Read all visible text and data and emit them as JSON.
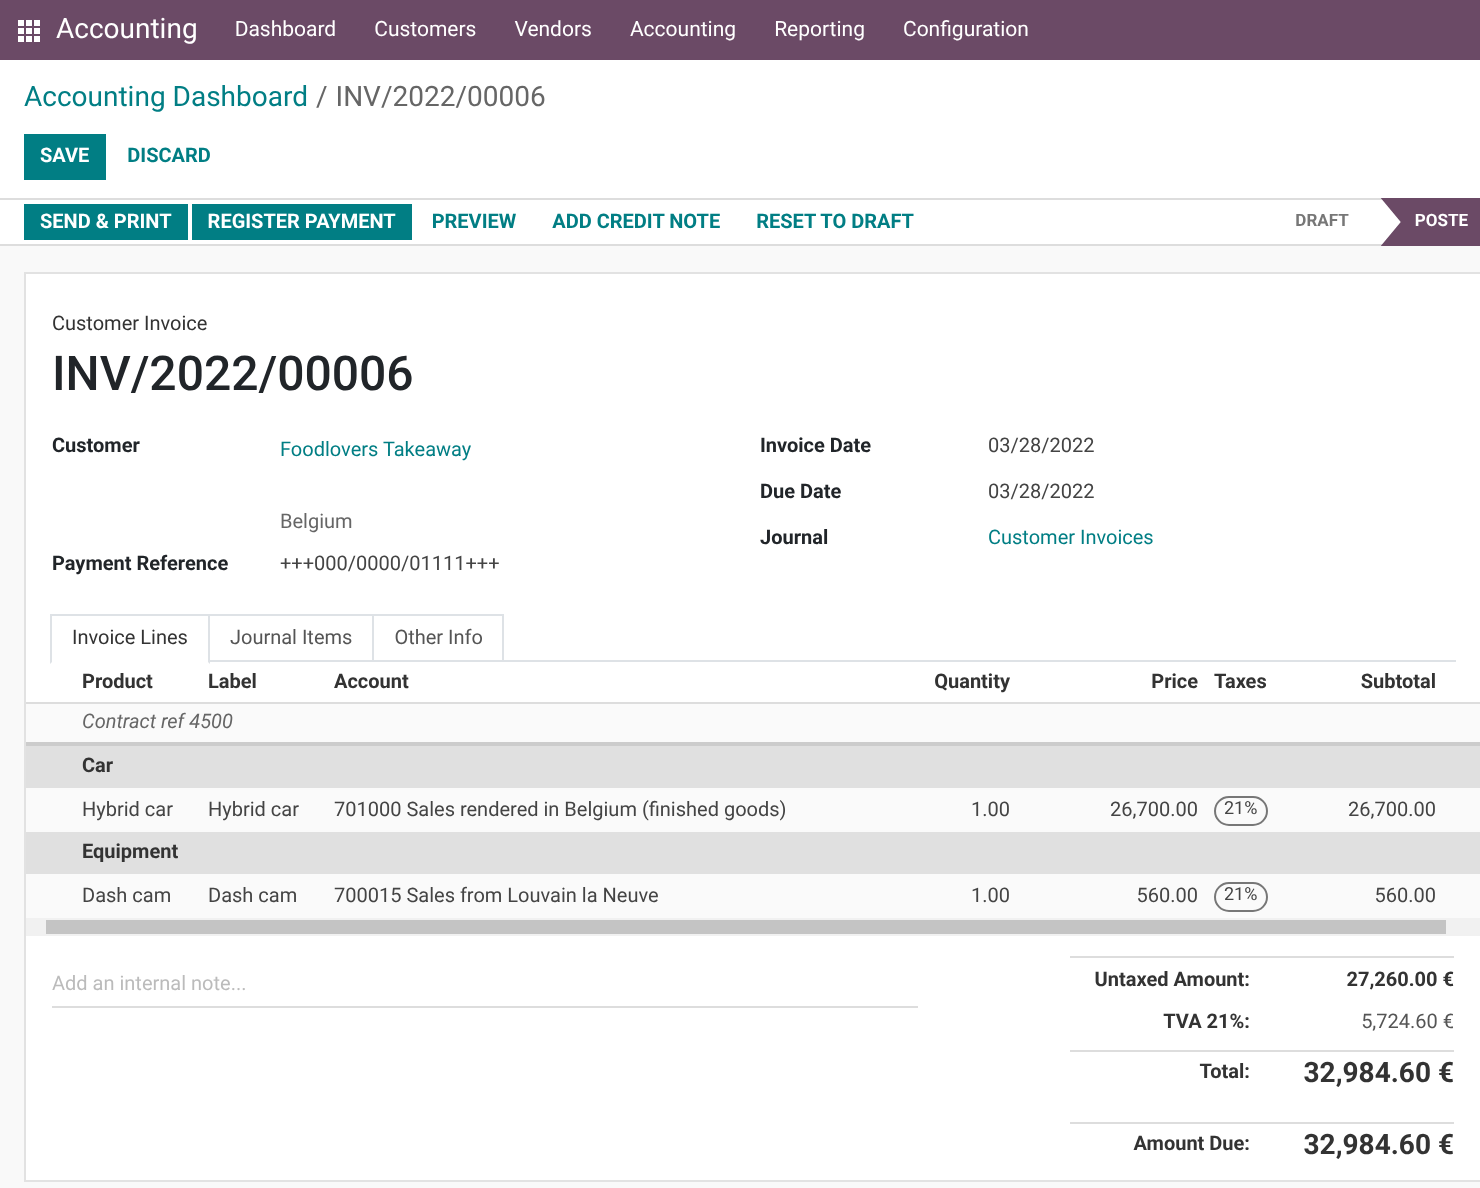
{
  "navbar": {
    "app": "Accounting",
    "menu": [
      "Dashboard",
      "Customers",
      "Vendors",
      "Accounting",
      "Reporting",
      "Configuration"
    ]
  },
  "breadcrumb": {
    "parent": "Accounting Dashboard",
    "separator": "/",
    "current": "INV/2022/00006"
  },
  "edit_buttons": [
    {
      "label": "SAVE",
      "kind": "primary"
    },
    {
      "label": "DISCARD",
      "kind": "link"
    }
  ],
  "actions": [
    {
      "label": "SEND & PRINT",
      "kind": "primary"
    },
    {
      "label": "REGISTER PAYMENT",
      "kind": "primary"
    },
    {
      "label": "PREVIEW",
      "kind": "link"
    },
    {
      "label": "ADD CREDIT NOTE",
      "kind": "link"
    },
    {
      "label": "RESET TO DRAFT",
      "kind": "link"
    }
  ],
  "status": [
    {
      "label": "DRAFT",
      "selected": false
    },
    {
      "label": "POSTE",
      "selected": true
    }
  ],
  "invoice": {
    "type": "Customer Invoice",
    "number": "INV/2022/00006"
  },
  "left_fields": [
    {
      "label": "Customer",
      "value": "Foodlovers Takeaway",
      "link": true,
      "extra": "Belgium"
    },
    {
      "label": "Payment Reference",
      "value": "+++000/0000/01111+++",
      "link": false
    }
  ],
  "right_fields": [
    {
      "label": "Invoice Date",
      "value": "03/28/2022",
      "link": false
    },
    {
      "label": "Due Date",
      "value": "03/28/2022",
      "link": false
    },
    {
      "label": "Journal",
      "value": "Customer Invoices",
      "link": true
    }
  ],
  "tabs": [
    {
      "label": "Invoice Lines",
      "selected": true
    },
    {
      "label": "Journal Items",
      "selected": false
    },
    {
      "label": "Other Info",
      "selected": false
    }
  ],
  "table": {
    "columns": [
      "Product",
      "Label",
      "Account",
      "Quantity",
      "Price",
      "Taxes",
      "Subtotal"
    ],
    "rows": [
      {
        "kind": "note",
        "text": "Contract ref 4500"
      },
      {
        "kind": "section",
        "text": "Car"
      },
      {
        "kind": "line",
        "product": "Hybrid car",
        "label": "Hybrid car",
        "account": "701000 Sales rendered in Belgium (finished goods)",
        "quantity": "1.00",
        "price": "26,700.00",
        "taxes": "21%",
        "subtotal": "26,700.00"
      },
      {
        "kind": "section",
        "text": "Equipment"
      },
      {
        "kind": "line",
        "product": "Dash cam",
        "label": "Dash cam",
        "account": "700015 Sales from Louvain la Neuve",
        "quantity": "1.00",
        "price": "560.00",
        "taxes": "21%",
        "subtotal": "560.00"
      }
    ]
  },
  "note": {
    "placeholder": "Add an internal note..."
  },
  "totals": [
    {
      "label": "Untaxed Amount:",
      "value": "27,260.00 €",
      "kind": "normal"
    },
    {
      "label": "TVA 21%:",
      "value": "5,724.60 €",
      "kind": "tax"
    },
    {
      "label": "Total:",
      "value": "32,984.60 €",
      "kind": "total"
    },
    {
      "label": "Amount Due:",
      "value": "32,984.60 €",
      "kind": "due"
    }
  ]
}
